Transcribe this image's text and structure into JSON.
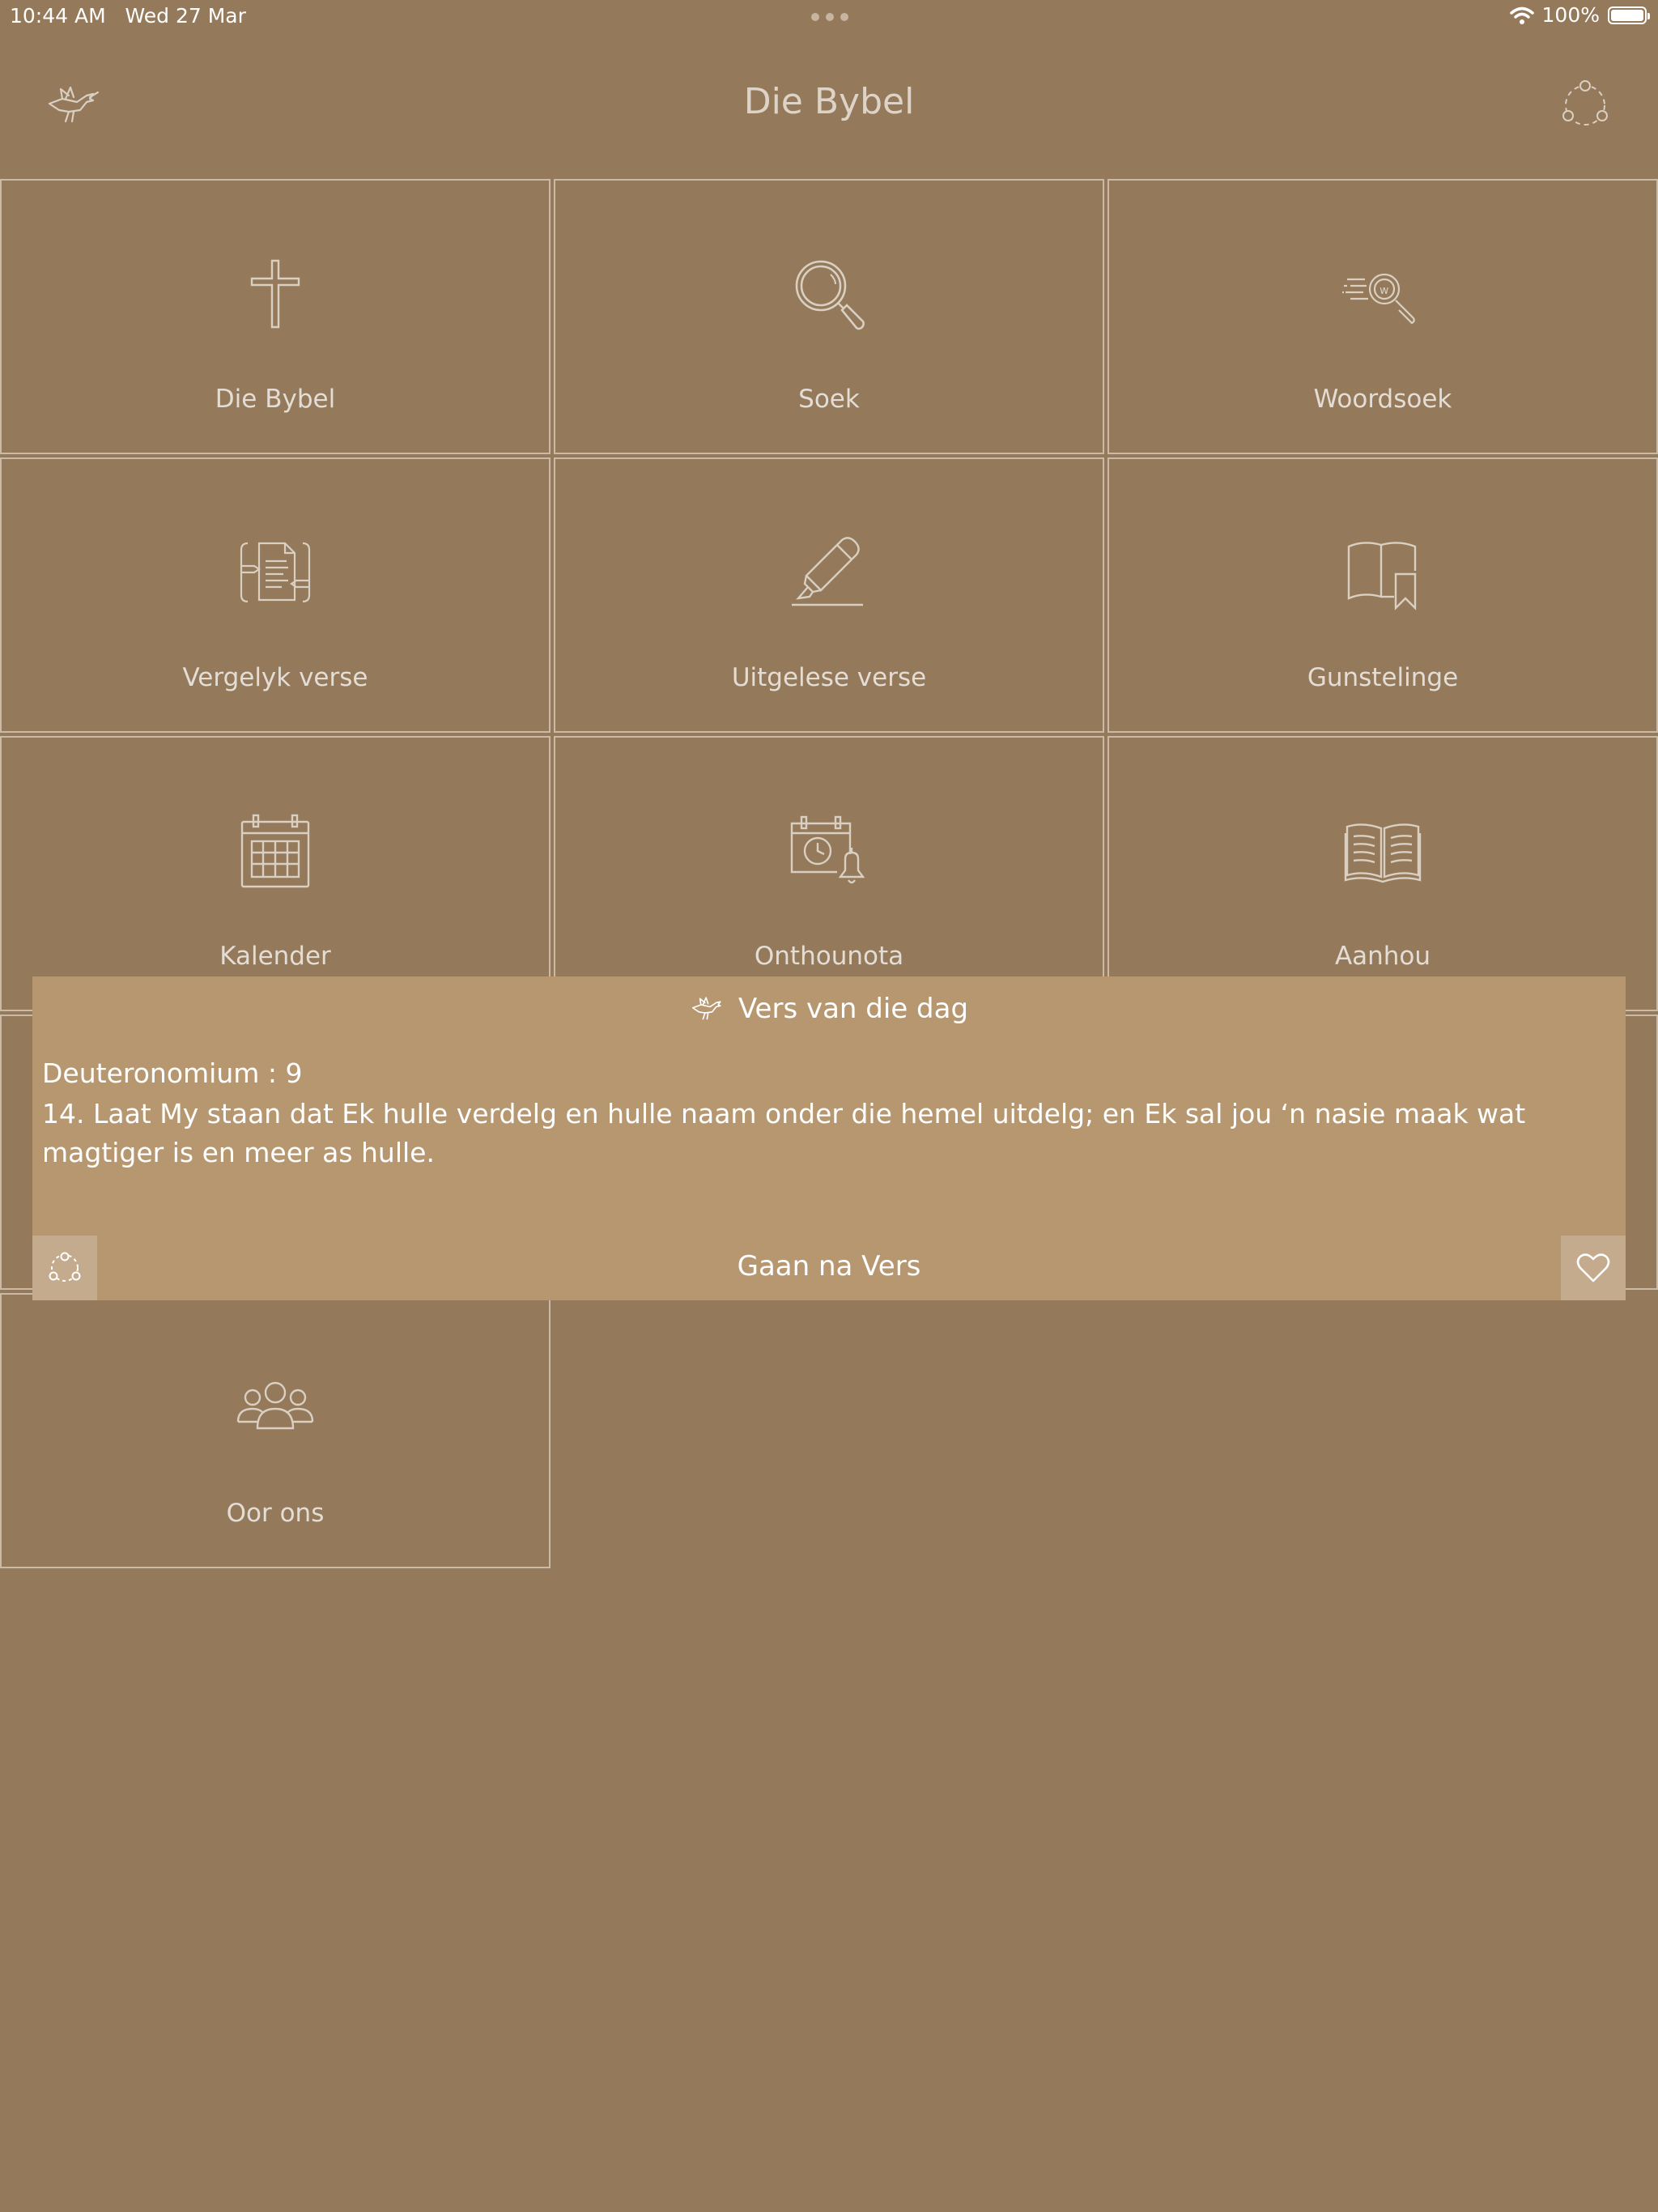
{
  "status": {
    "time": "10:44 AM",
    "date": "Wed 27 Mar",
    "battery": "100%"
  },
  "header": {
    "title": "Die Bybel",
    "left_icon": "dove-icon",
    "right_icon": "share-icon"
  },
  "tiles": [
    {
      "label": "Die Bybel",
      "icon": "cross-icon"
    },
    {
      "label": "Soek",
      "icon": "search-icon"
    },
    {
      "label": "Woordsoek",
      "icon": "word-search-icon"
    },
    {
      "label": "Vergelyk verse",
      "icon": "compare-verses-icon"
    },
    {
      "label": "Uitgelese verse",
      "icon": "highlighter-icon"
    },
    {
      "label": "Gunstelinge",
      "icon": "bookmark-book-icon"
    },
    {
      "label": "Kalender",
      "icon": "calendar-icon"
    },
    {
      "label": "Onthounota",
      "icon": "reminder-calendar-icon"
    },
    {
      "label": "Aanhou",
      "icon": "open-book-icon"
    },
    {
      "label": "Oor ons",
      "icon": "group-icon"
    }
  ],
  "verse_of_day": {
    "title": "Vers van die dag",
    "reference": "Deuteronomium : 9",
    "text": "14. Laat My staan dat Ek hulle verdelg en hulle naam onder die hemel uitdelg; en Ek sal jou ‘n nasie maak wat magtiger is en meer as hulle.",
    "goto_label": "Gaan na Vers"
  }
}
